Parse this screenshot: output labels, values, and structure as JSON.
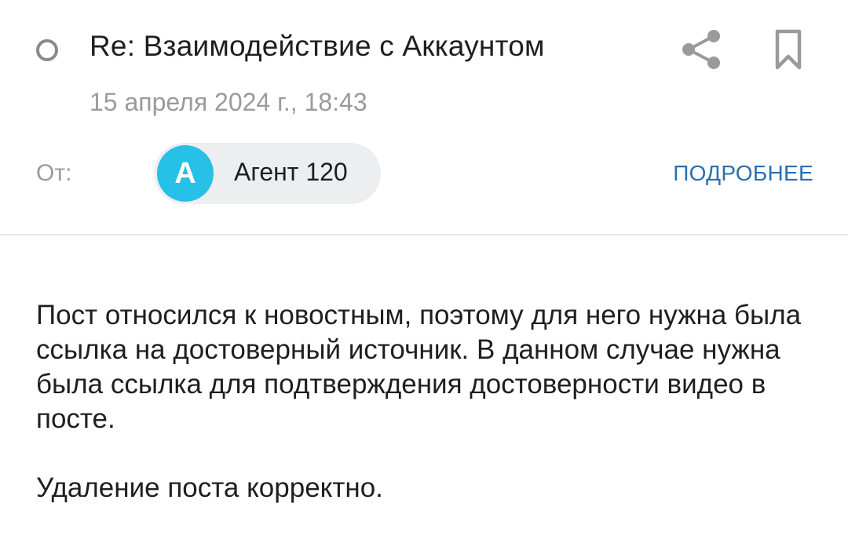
{
  "header": {
    "subject": "Re: Взаимодействие с Аккаунтом",
    "date": "15 апреля 2024 г., 18:43",
    "from_label": "От:",
    "sender": {
      "avatar_letter": "A",
      "name": "Агент 120"
    },
    "details_link": "ПОДРОБНЕЕ",
    "icons": [
      "status-circle-icon",
      "share-icon",
      "bookmark-icon"
    ]
  },
  "message": {
    "paragraphs": [
      "Пост относился к новостным, поэтому для него нужна была ссылка на достоверный источник. В данном случае нужна была ссылка для подтверждения достоверности видео в посте.",
      "Удаление поста корректно."
    ]
  },
  "colors": {
    "avatar_bg": "#27c0e6",
    "link": "#2a6fb0",
    "muted_text": "#9a9a9a",
    "chip_bg": "#eceef0"
  }
}
